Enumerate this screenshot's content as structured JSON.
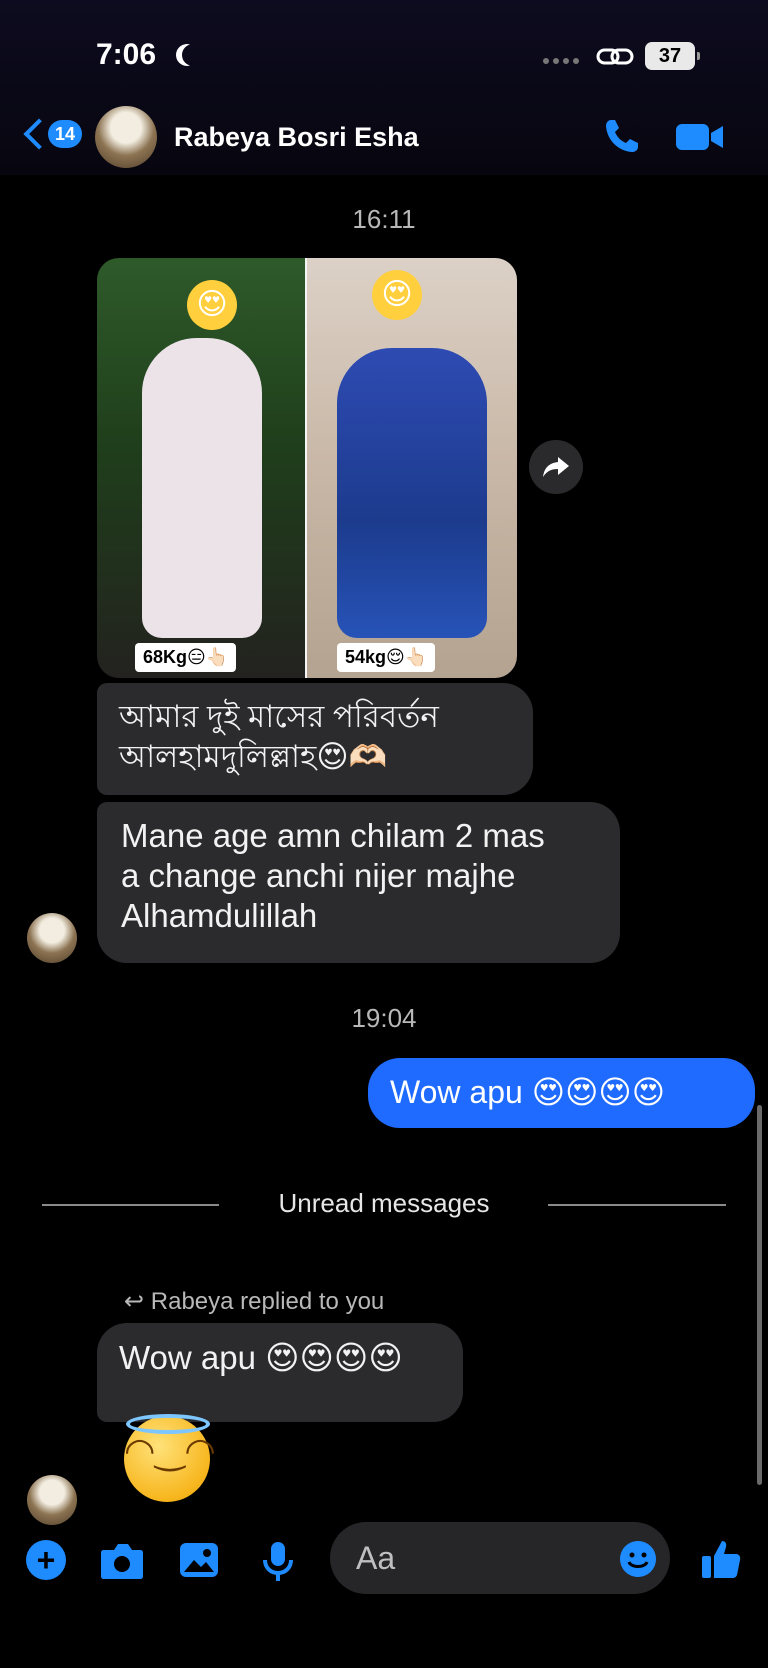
{
  "status_bar": {
    "time": "7:06",
    "battery": "37"
  },
  "header": {
    "back_count": "14",
    "contact_name": "Rabeya Bosri Esha"
  },
  "messages": {
    "time_1": "16:11",
    "photo_labels": {
      "left": "68Kg😑👆🏻",
      "right": "54kg😌👆🏻"
    },
    "bubble_bengali_1": "আমার দুই মাসের পরিবর্তন",
    "bubble_bengali_2": "আলহামদুলিল্লাহ😍🫶🏻",
    "bubble_text_1": "Mane age amn chilam 2 mas",
    "bubble_text_2": "a change anchi nijer majhe",
    "bubble_text_3": "Alhamdulillah",
    "time_2": "19:04",
    "outgoing": "Wow apu 😍😍😍😍",
    "unread": "Unread messages",
    "reply_note": "Rabeya replied to you",
    "reply_bubble": "Wow apu 😍😍😍😍"
  },
  "composer": {
    "placeholder": "Aa"
  },
  "colors": {
    "accent": "#1e8bff",
    "outgoing_bubble": "#1f6bff",
    "incoming_bubble": "#2b2b2d"
  }
}
